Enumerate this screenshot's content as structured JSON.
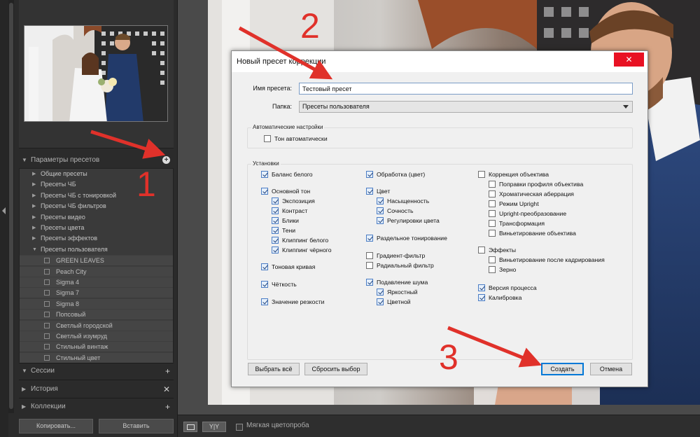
{
  "left_panel": {
    "sections": {
      "presets": {
        "title": "Параметры пресетов"
      },
      "sessions": {
        "title": "Сессии"
      },
      "history": {
        "title": "История"
      },
      "collections": {
        "title": "Коллекции"
      }
    },
    "preset_tree": {
      "folders": [
        "Общие пресеты",
        "Пресеты ЧБ",
        "Пресеты ЧБ с тонировкой",
        "Пресеты ЧБ фильтров",
        "Пресеты видео",
        "Пресеты цвета",
        "Пресеты эффектов",
        "Пресеты пользователя"
      ],
      "user_presets": [
        "GREEN LEAVES",
        "Peach City",
        "Sigma 4",
        "Sigma 7",
        "Sigma 8",
        "Попсовый",
        "Светлый городской",
        "Светлый изумруд",
        "Стильный винтаж",
        "Стильный цвет"
      ]
    },
    "buttons": {
      "copy": "Копировать...",
      "paste": "Вставить"
    }
  },
  "filmstrip": {
    "view_label": "Y|Y",
    "soft_proof": "Мягкая цветопроба"
  },
  "dialog": {
    "title": "Новый пресет коррекции",
    "close_glyph": "✕",
    "name_label": "Имя пресета:",
    "name_value": "Тестовый пресет",
    "folder_label": "Папка:",
    "folder_value": "Пресеты пользователя",
    "auto_group": {
      "title": "Автоматические настройки",
      "auto_tone": "Тон автоматически"
    },
    "settings_group": {
      "title": "Установки",
      "col1": {
        "white_balance": "Баланс белого",
        "basic_tone": "Основной тон",
        "exposure": "Экспозиция",
        "contrast": "Контраст",
        "highlights": "Блики",
        "shadows": "Тени",
        "white_clipping": "Клиппинг белого",
        "black_clipping": "Клиппинг чёрного",
        "tone_curve": "Тоновая кривая",
        "clarity": "Чёткость",
        "sharpness": "Значение резкости"
      },
      "col2": {
        "color_treatment": "Обработка (цвет)",
        "color": "Цвет",
        "saturation": "Насыщенность",
        "vibrance": "Сочность",
        "color_adjust": "Регулировки цвета",
        "split_toning": "Раздельное тонирование",
        "graduated_filter": "Градиент-фильтр",
        "radial_filter": "Радиальный фильтр",
        "noise_reduction": "Подавление шума",
        "luminance": "Яркостный",
        "noise_color": "Цветной"
      },
      "col3": {
        "lens_correction": "Коррекция объектива",
        "profile_corrections": "Поправки профиля объектива",
        "chromatic_aberration": "Хроматическая аберрация",
        "upright_mode": "Режим Upright",
        "upright_transform": "Upright-преобразование",
        "transform": "Трансформация",
        "lens_vignetting": "Виньетирование объектива",
        "effects": "Эффекты",
        "post_crop_vignetting": "Виньетирование после кадрирования",
        "grain": "Зерно",
        "process_version": "Версия процесса",
        "calibration": "Калибровка"
      }
    },
    "buttons": {
      "select_all": "Выбрать всё",
      "reset": "Сбросить выбор",
      "create": "Создать",
      "cancel": "Отмена"
    }
  },
  "annotations": {
    "step1": "1",
    "step2": "2",
    "step3": "3"
  },
  "colors": {
    "annotation": "#e0312a",
    "close_button": "#e81123",
    "primary_border": "#0078d7"
  }
}
